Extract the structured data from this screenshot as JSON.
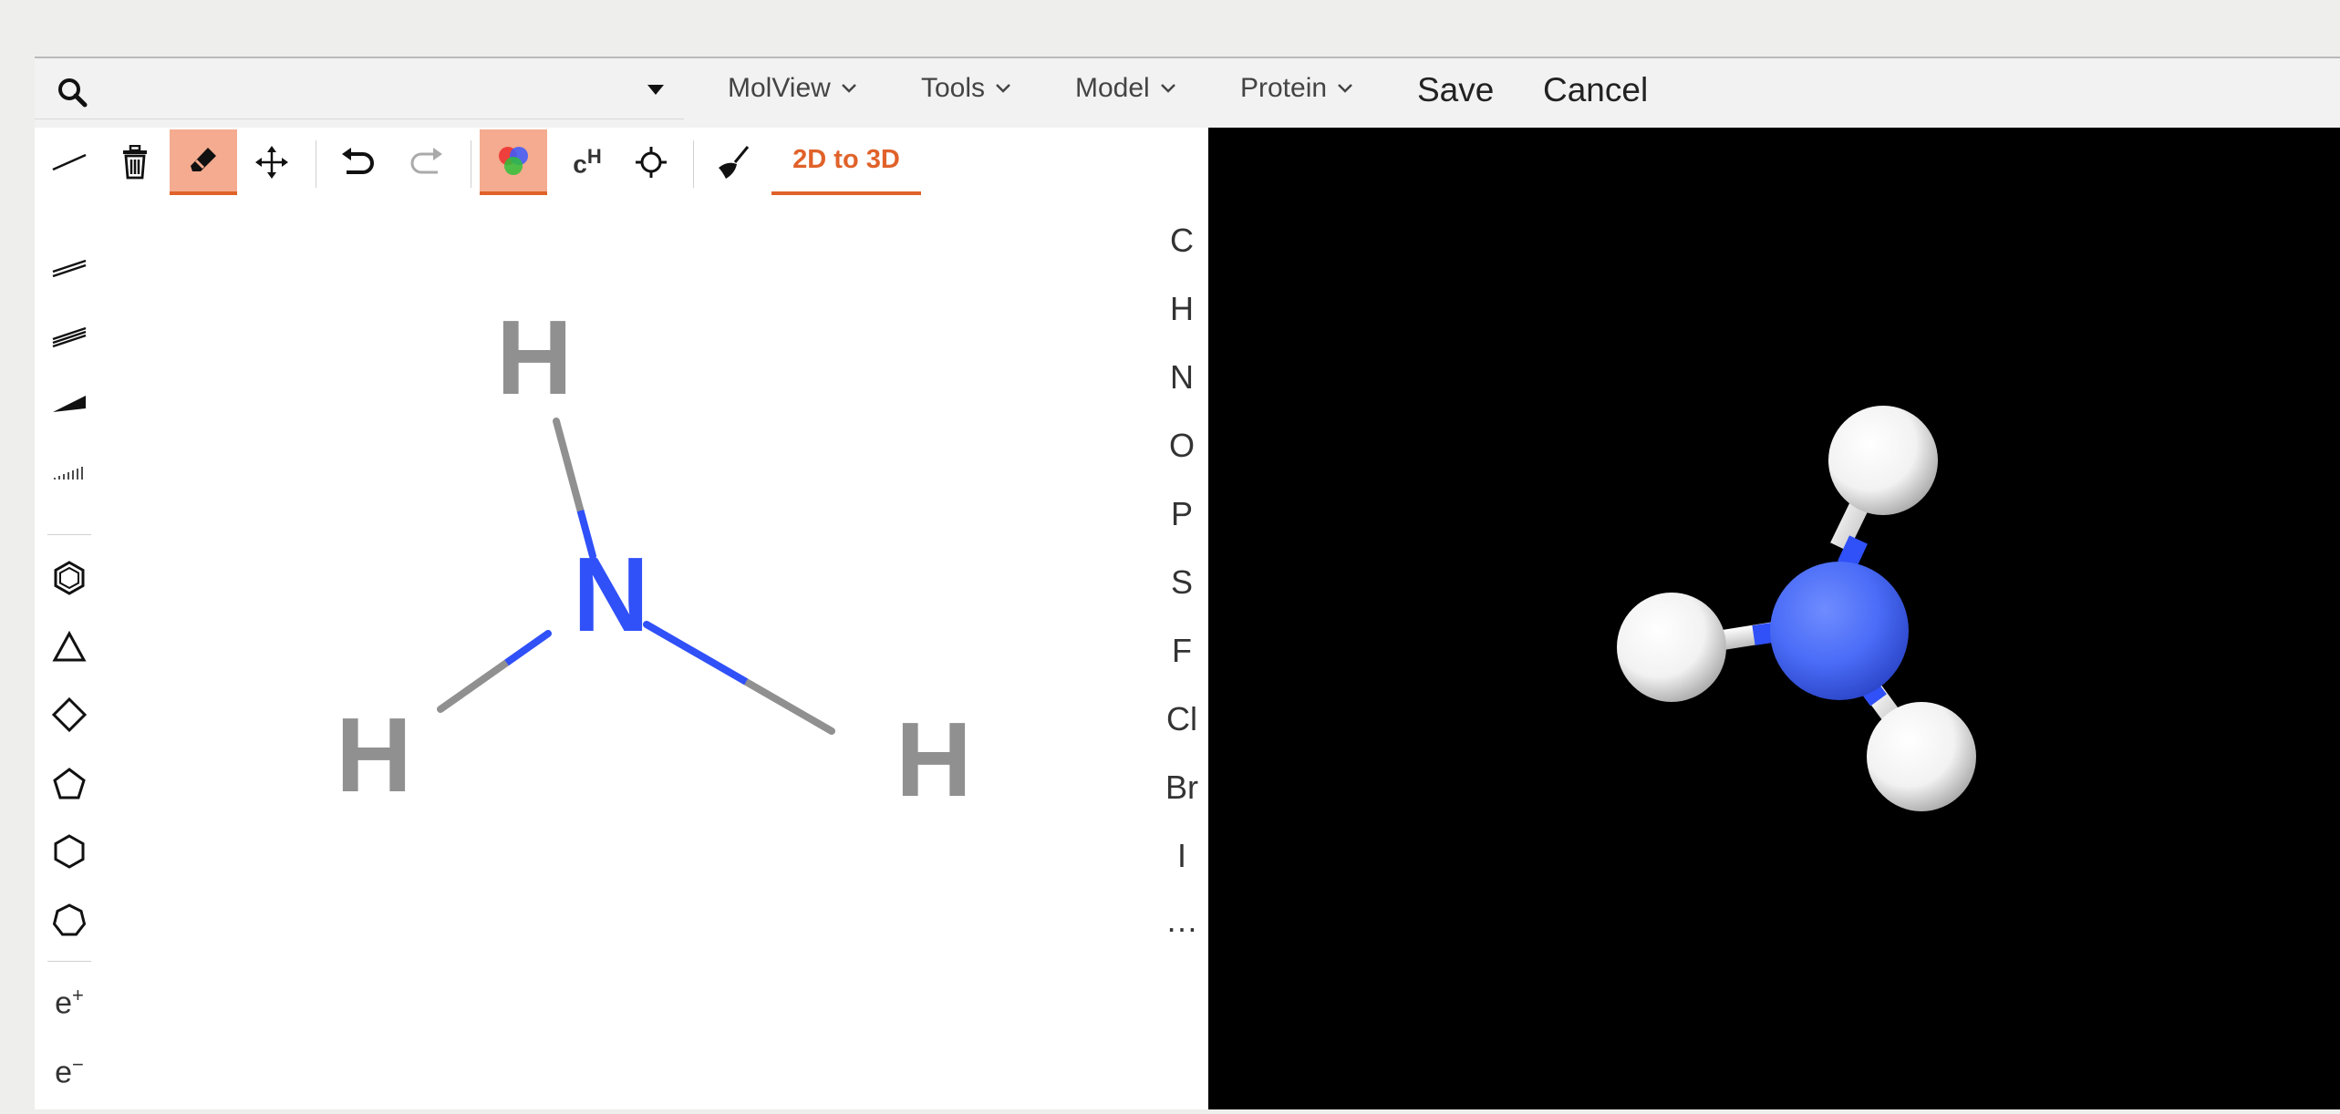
{
  "search": {
    "value": "",
    "placeholder": ""
  },
  "menus": [
    {
      "label": "MolView"
    },
    {
      "label": "Tools"
    },
    {
      "label": "Model"
    },
    {
      "label": "Protein"
    }
  ],
  "actions": {
    "save": "Save",
    "cancel": "Cancel"
  },
  "toolbar": {
    "convert_label": "2D to 3D",
    "add_h_label": "c",
    "add_h_sup": "H"
  },
  "charges": {
    "pos": "e",
    "pos_sup": "+",
    "neg": "e",
    "neg_sup": "−"
  },
  "elements": [
    "C",
    "H",
    "N",
    "O",
    "P",
    "S",
    "F",
    "Cl",
    "Br",
    "I",
    "…"
  ],
  "molecule2d": {
    "atoms": [
      {
        "symbol": "N",
        "color": "#3050f8"
      },
      {
        "symbol": "H",
        "color": "#909090"
      },
      {
        "symbol": "H",
        "color": "#909090"
      },
      {
        "symbol": "H",
        "color": "#909090"
      }
    ]
  },
  "colors": {
    "accent": "#e0622a",
    "active_bg": "#f4ab8f",
    "nitrogen": "#3050f8",
    "hydrogen": "#909090",
    "viewer_bg": "#000000"
  }
}
